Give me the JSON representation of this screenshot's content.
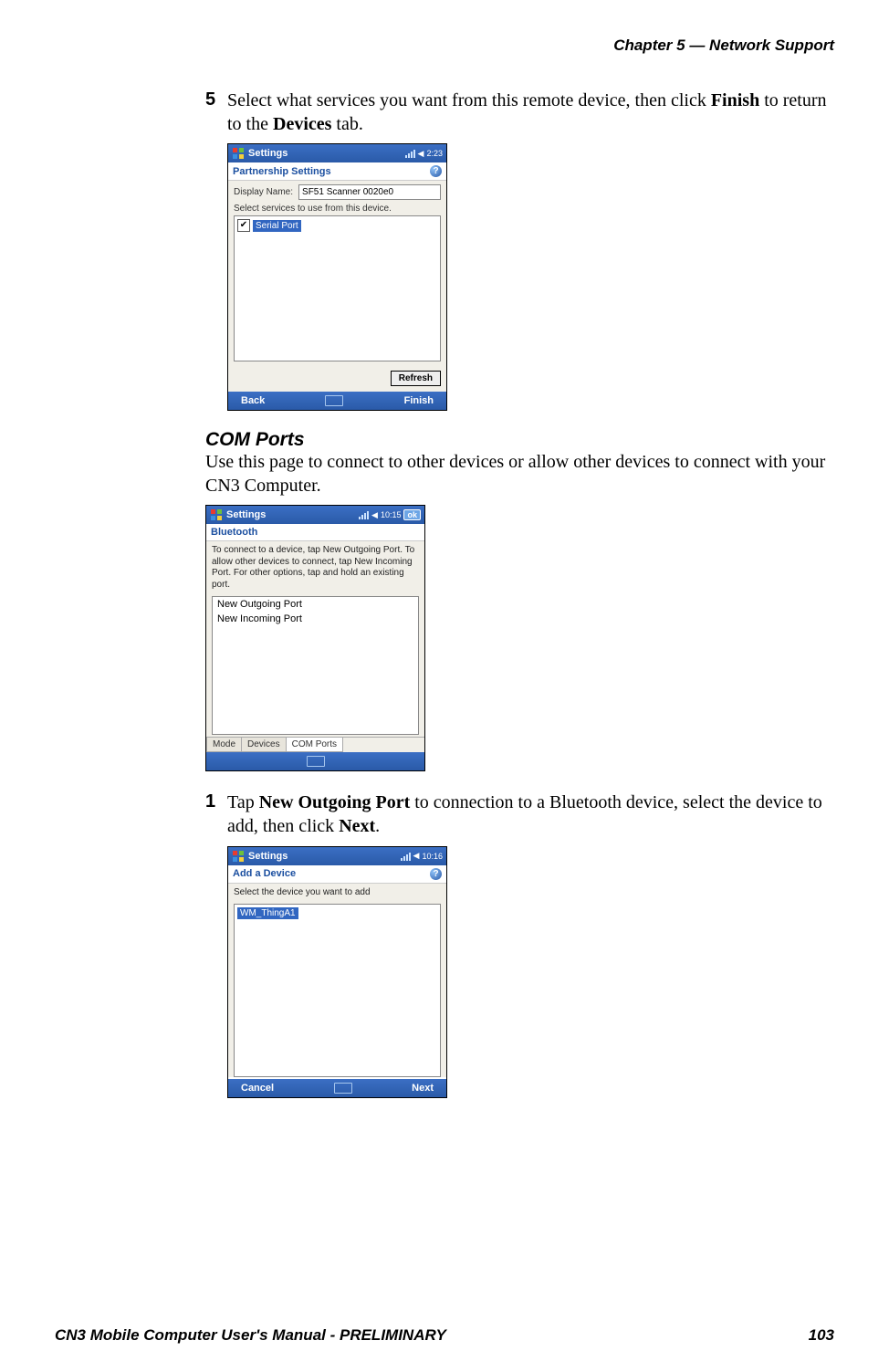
{
  "chapter_header": "Chapter 5 —  Network Support",
  "step5": {
    "num": "5",
    "text_a": "Select what services you want from this remote device, then click ",
    "bold_a": "Finish",
    "text_b": " to return to the ",
    "bold_b": "Devices",
    "text_c": " tab."
  },
  "shot1": {
    "title": "Settings",
    "time": "2:23",
    "sub": "Partnership Settings",
    "display_label": "Display Name:",
    "display_value": "SF51 Scanner 0020e0",
    "instr": "Select services to use from this device.",
    "service": "Serial Port",
    "refresh": "Refresh",
    "back": "Back",
    "finish": "Finish"
  },
  "section_heading": "COM Ports",
  "section_para": "Use this page to connect to other devices or allow other devices to connect with your CN3 Computer.",
  "shot2": {
    "title": "Settings",
    "time": "10:15",
    "ok": "ok",
    "sub": "Bluetooth",
    "instr": "To connect to a device, tap New Outgoing Port. To allow other devices to connect, tap New Incoming Port. For other options, tap and hold an existing port.",
    "items": [
      "New Outgoing Port",
      "New Incoming Port"
    ],
    "tabs": [
      "Mode",
      "Devices",
      "COM Ports"
    ]
  },
  "step1": {
    "num": "1",
    "text_a": "Tap ",
    "bold_a": "New Outgoing Port",
    "text_b": " to connection to a Bluetooth device, select the device to add, then click ",
    "bold_b": "Next",
    "text_c": "."
  },
  "shot3": {
    "title": "Settings",
    "time": "10:16",
    "sub": "Add a Device",
    "instr": "Select the device you want to add",
    "item": "WM_ThingA1",
    "cancel": "Cancel",
    "next": "Next"
  },
  "footer_left": "CN3 Mobile Computer User's Manual - PRELIMINARY",
  "footer_right": "103"
}
